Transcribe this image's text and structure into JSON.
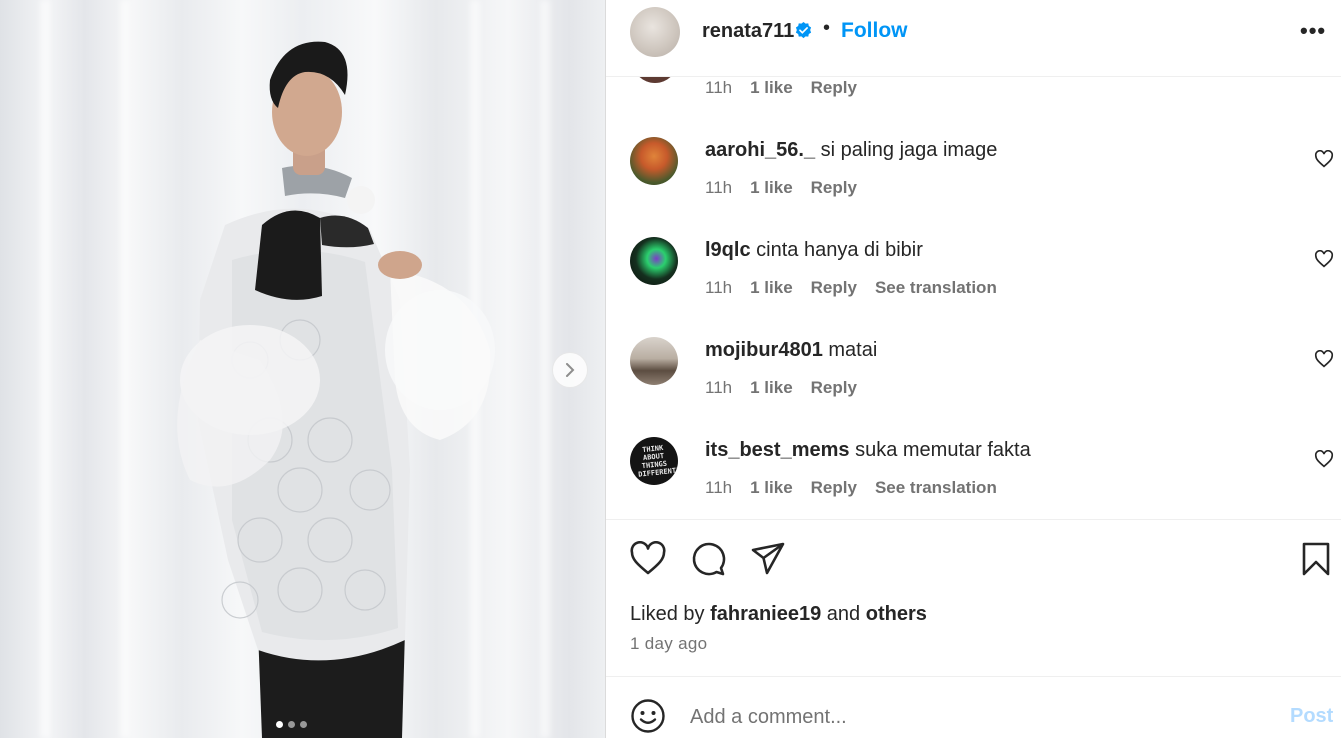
{
  "post": {
    "username": "renata711",
    "separator": "•",
    "follow_label": "Follow",
    "more_label": "•••",
    "slide_count": 3,
    "active_slide": 1
  },
  "partial_comment": {
    "time": "11h",
    "likes": "1 like",
    "reply": "Reply"
  },
  "comments": [
    {
      "username": "aarohi_56._",
      "text": "si paling jaga image",
      "time": "11h",
      "likes": "1 like",
      "reply": "Reply",
      "translate": ""
    },
    {
      "username": "l9qlc",
      "text": "cinta hanya di bibir",
      "time": "11h",
      "likes": "1 like",
      "reply": "Reply",
      "translate": "See translation"
    },
    {
      "username": "mojibur4801",
      "text": "matai",
      "time": "11h",
      "likes": "1 like",
      "reply": "Reply",
      "translate": ""
    },
    {
      "username": "its_best_mems",
      "text": "suka memutar fakta",
      "time": "11h",
      "likes": "1 like",
      "reply": "Reply",
      "translate": "See translation"
    }
  ],
  "avatar_text": {
    "its_best_mems": "THINK ABOUT THINGS DIFFERENTLY"
  },
  "likes": {
    "prefix": "Liked by",
    "user": "fahraniee19",
    "middle": "and",
    "others": "others"
  },
  "timestamp": "1 day ago",
  "composer": {
    "placeholder": "Add a comment...",
    "post_label": "Post"
  },
  "colors": {
    "accent": "#0095f6",
    "post_disabled": "#b3dbff",
    "verified": "#0095f6"
  }
}
